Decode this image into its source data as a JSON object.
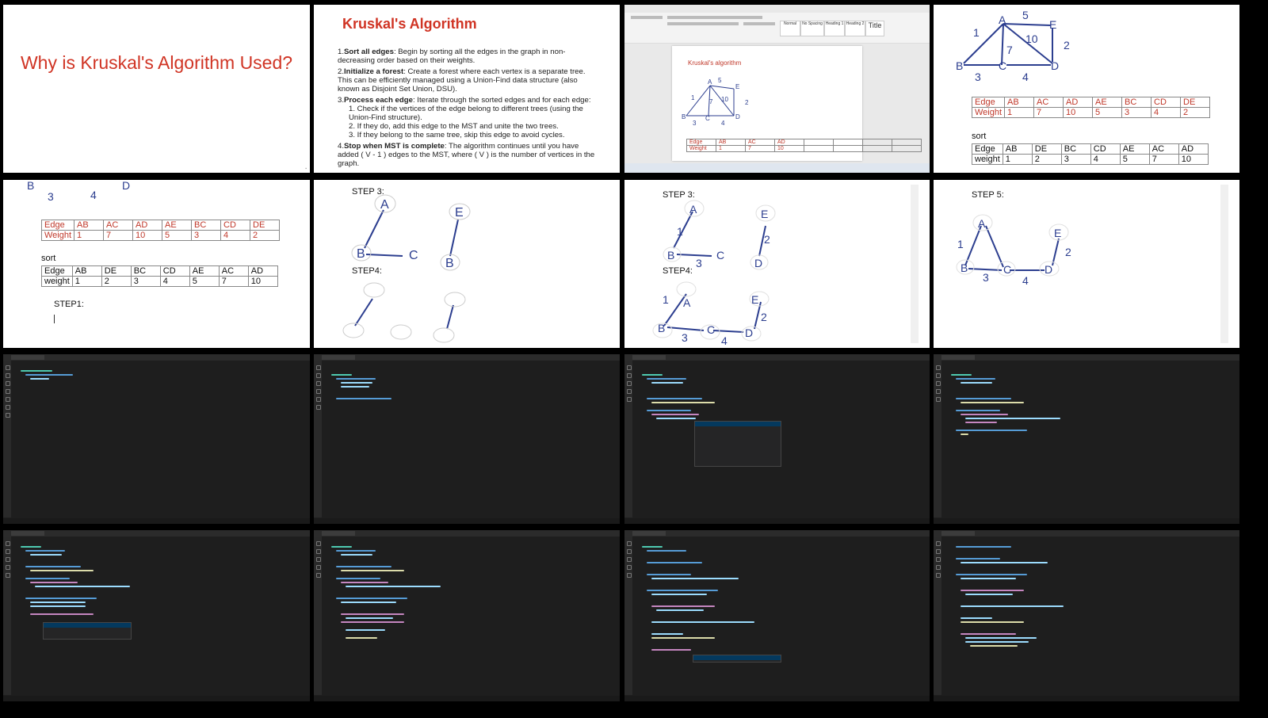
{
  "slide1": {
    "title": "Why is Kruskal's Algorithm Used?"
  },
  "slide2": {
    "title": "Kruskal's Algorithm",
    "items": [
      {
        "num": "1.",
        "head": "Sort all edges",
        "text": ": Begin by sorting all the edges in the graph in non-decreasing order based on their weights."
      },
      {
        "num": "2.",
        "head": "Initialize a forest",
        "text": ": Create a forest where each vertex is a separate tree. This can be efficiently managed using a Union-Find data structure (also known as Disjoint Set Union, DSU)."
      },
      {
        "num": "3.",
        "head": "Process each edge",
        "text": ": Iterate through the sorted edges and for each edge:"
      },
      {
        "num": "4.",
        "head": "Stop when MST is complete",
        "text": ": The algorithm continues until you have added ( V - 1 ) edges to the MST, where ( V ) is the number of vertices in the graph."
      }
    ],
    "subitems": [
      "1. Check if the vertices of the edge belong to different trees (using the Union-Find structure).",
      "2. If they do, add this edge to the MST and unite the two trees.",
      "3. If they belong to the same tree, skip this edge to avoid cycles."
    ]
  },
  "word": {
    "doc_heading": "Kruskal's algorithm",
    "table_row1": [
      "Edge",
      "AB",
      "AC",
      "AD",
      "",
      "",
      "",
      ""
    ],
    "table_row2": [
      "Weight",
      "1",
      "7",
      "10",
      "",
      "",
      "",
      ""
    ],
    "title_style": "Title",
    "styles": [
      "Normal",
      "No Spacing",
      "Heading 1",
      "Heading 2"
    ]
  },
  "graph_labels": {
    "vertices": [
      "A",
      "B",
      "C",
      "D",
      "E"
    ],
    "weights": [
      "1",
      "5",
      "7",
      "10",
      "2",
      "3",
      "4"
    ]
  },
  "edge_table": {
    "row1": [
      "Edge",
      "AB",
      "AC",
      "AD",
      "AE",
      "BC",
      "CD",
      "DE"
    ],
    "row2": [
      "Weight",
      "1",
      "7",
      "10",
      "5",
      "3",
      "4",
      "2"
    ]
  },
  "sorted_table": {
    "label": "sort",
    "row1": [
      "Edge",
      "AB",
      "DE",
      "BC",
      "CD",
      "AE",
      "AC",
      "AD"
    ],
    "row2": [
      "weight",
      "1",
      "2",
      "3",
      "4",
      "5",
      "7",
      "10"
    ]
  },
  "steps": {
    "step1": "STEP1:",
    "step3": "STEP 3:",
    "step4": "STEP4:",
    "step5": "STEP 5:"
  },
  "colors": {
    "accent_red": "#d03424",
    "editor_bg": "#1e1e1e",
    "ink": "#2c3e8f"
  }
}
